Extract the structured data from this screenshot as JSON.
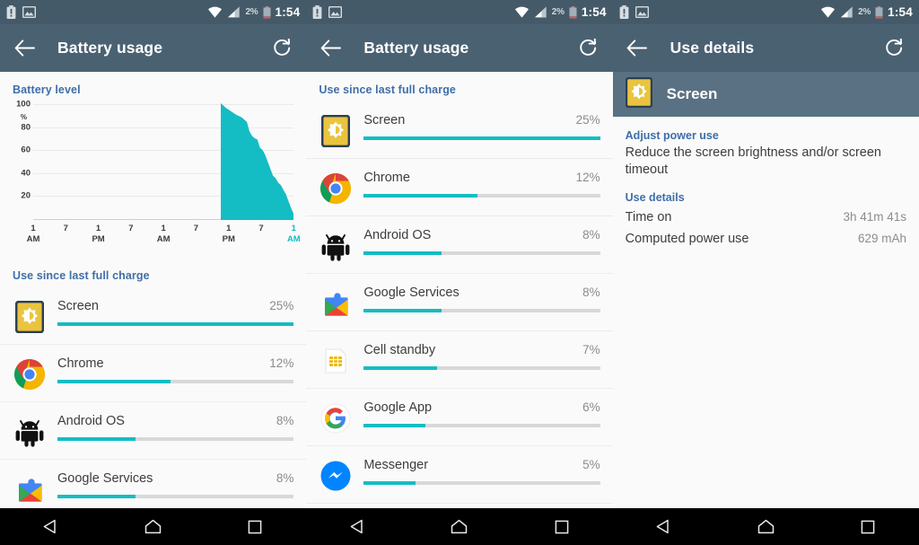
{
  "status_bar": {
    "left_icons": [
      "battery-alert-icon",
      "image-icon"
    ],
    "wifi_icon": "wifi-icon",
    "signal_icon": "cell-signal-icon",
    "battery_percent": "2%",
    "battery_icon": "battery-icon",
    "time": "1:54"
  },
  "colors": {
    "toolbar": "#4a6172",
    "statusbar": "#455a68",
    "subheader": "#5a7183",
    "accent_teal": "#14bcc4",
    "section_blue": "#3f6ea8",
    "track_grey": "#d8d8d8",
    "page_bg": "#fafafa"
  },
  "panels": [
    {
      "toolbar": {
        "back_icon": "arrow-back-icon",
        "title": "Battery usage",
        "refresh_icon": "refresh-icon"
      },
      "chart_section_label": "Battery level",
      "list_section_label": "Use since last full charge",
      "apps": [
        {
          "name": "Screen",
          "percent": "25%",
          "fill": 100,
          "icon": "screen-brightness-icon"
        },
        {
          "name": "Chrome",
          "percent": "12%",
          "fill": 48,
          "icon": "chrome-icon"
        },
        {
          "name": "Android OS",
          "percent": "8%",
          "fill": 33,
          "icon": "android-icon"
        },
        {
          "name": "Google Services",
          "percent": "8%",
          "fill": 33,
          "icon": "google-play-services-icon"
        }
      ]
    },
    {
      "toolbar": {
        "back_icon": "arrow-back-icon",
        "title": "Battery usage",
        "refresh_icon": "refresh-icon"
      },
      "list_section_label": "Use since last full charge",
      "apps": [
        {
          "name": "Screen",
          "percent": "25%",
          "fill": 100,
          "icon": "screen-brightness-icon"
        },
        {
          "name": "Chrome",
          "percent": "12%",
          "fill": 48,
          "icon": "chrome-icon"
        },
        {
          "name": "Android OS",
          "percent": "8%",
          "fill": 33,
          "icon": "android-icon"
        },
        {
          "name": "Google Services",
          "percent": "8%",
          "fill": 33,
          "icon": "google-play-services-icon"
        },
        {
          "name": "Cell standby",
          "percent": "7%",
          "fill": 31,
          "icon": "sim-card-icon"
        },
        {
          "name": "Google App",
          "percent": "6%",
          "fill": 26,
          "icon": "google-g-icon"
        },
        {
          "name": "Messenger",
          "percent": "5%",
          "fill": 22,
          "icon": "messenger-icon"
        }
      ]
    },
    {
      "toolbar": {
        "back_icon": "arrow-back-icon",
        "title": "Use details",
        "refresh_icon": "refresh-icon"
      },
      "subheader": {
        "title": "Screen",
        "icon": "screen-brightness-icon"
      },
      "adjust_label": "Adjust power use",
      "adjust_text": "Reduce the screen brightness and/or screen timeout",
      "details_label": "Use details",
      "details": [
        {
          "key": "Time on",
          "value": "3h 41m 41s"
        },
        {
          "key": "Computed power use",
          "value": "629 mAh"
        }
      ]
    }
  ],
  "nav_bar": {
    "back": "nav-back-icon",
    "home": "nav-home-icon",
    "recents": "nav-recents-icon"
  },
  "chart_data": {
    "type": "area",
    "title": "Battery level",
    "xlabel": "",
    "ylabel": "%",
    "ylim": [
      0,
      100
    ],
    "yticks": [
      100,
      80,
      60,
      40,
      20
    ],
    "grid": true,
    "legend": false,
    "xticks": [
      {
        "top": "1",
        "bottom": "AM",
        "highlight": false
      },
      {
        "top": "7",
        "bottom": "",
        "highlight": false
      },
      {
        "top": "1",
        "bottom": "PM",
        "highlight": false
      },
      {
        "top": "7",
        "bottom": "",
        "highlight": false
      },
      {
        "top": "1",
        "bottom": "AM",
        "highlight": false
      },
      {
        "top": "7",
        "bottom": "",
        "highlight": false
      },
      {
        "top": "1",
        "bottom": "PM",
        "highlight": false
      },
      {
        "top": "7",
        "bottom": "",
        "highlight": false
      },
      {
        "top": "1",
        "bottom": "AM",
        "highlight": true
      }
    ],
    "series": [
      {
        "name": "Battery level",
        "color": "#14bcc4",
        "x": [
          0,
          72,
          74,
          76,
          78,
          80,
          81,
          82,
          83,
          84,
          85,
          86,
          87,
          88,
          89,
          90,
          91,
          92,
          93,
          94,
          95,
          96,
          97,
          98,
          99,
          100
        ],
        "values": [
          null,
          100,
          96,
          93,
          90,
          88,
          86,
          84,
          76,
          72,
          70,
          69,
          62,
          60,
          56,
          50,
          44,
          38,
          36,
          32,
          30,
          26,
          22,
          16,
          10,
          5
        ]
      }
    ]
  }
}
